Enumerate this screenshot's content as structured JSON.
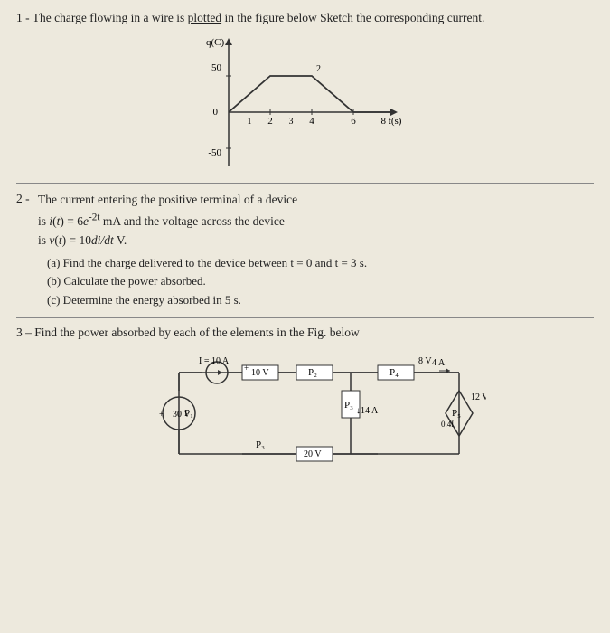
{
  "problem1": {
    "text": "1 - The charge flowing in a wire is",
    "text2": "plotted",
    "text3": "in the figure below Sketch the corresponding current.",
    "graph": {
      "xLabel": "t(s)",
      "yLabel": "q(C)",
      "yMax": 50,
      "yMin": -50,
      "xMax": 8,
      "points": [
        [
          0,
          0
        ],
        [
          2,
          50
        ],
        [
          4,
          50
        ],
        [
          6,
          0
        ],
        [
          8,
          0
        ]
      ]
    }
  },
  "problem2": {
    "number": "2 -",
    "line1": "The current entering the positive terminal of a device",
    "line2": "is i(t) = 6e",
    "exp": "-2t",
    "line2b": " mA and the voltage across the device",
    "line3": "is v(t) = 10di/dt V.",
    "parts": {
      "a": "(a) Find the charge delivered to the device between t = 0 and t = 3 s.",
      "b": "(b) Calculate the power absorbed.",
      "c": "(c) Determine the energy absorbed in 5 s."
    }
  },
  "problem3": {
    "text": "3 – Find the power absorbed by each of the elements in the Fig. below",
    "circuit": {
      "I_source": "I = 10 A",
      "V1": "10 V",
      "V2": "8 V",
      "I2": "4 A",
      "I3": "14 A",
      "V3": "30 V",
      "V4": "20 V",
      "V5": "12 V",
      "I4": "0.4I",
      "labels": [
        "P1",
        "P2",
        "P3",
        "P4",
        "P5"
      ]
    }
  }
}
